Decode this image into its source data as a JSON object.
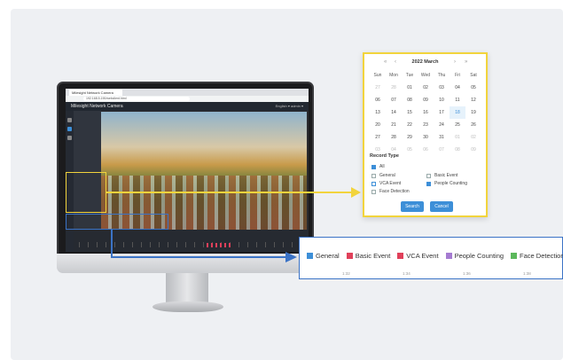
{
  "browser": {
    "tab_title": "Milesight Network Camera",
    "url": "192.168.5.190/webclient.html"
  },
  "app": {
    "brand": "Milesight Network Camera",
    "header_right": "English ▾   admin ▾"
  },
  "calendar": {
    "prev_year": "«",
    "prev_month": "‹",
    "title": "2022 March",
    "next_month": "›",
    "next_year": "»",
    "days_of_week": [
      "Sun",
      "Mon",
      "Tue",
      "Wed",
      "Thu",
      "Fri",
      "Sat"
    ],
    "weeks": [
      [
        "27",
        "28",
        "01",
        "02",
        "03",
        "04",
        "05"
      ],
      [
        "06",
        "07",
        "08",
        "09",
        "10",
        "11",
        "12"
      ],
      [
        "13",
        "14",
        "15",
        "16",
        "17",
        "18",
        "19"
      ],
      [
        "20",
        "21",
        "22",
        "23",
        "24",
        "25",
        "26"
      ],
      [
        "27",
        "28",
        "29",
        "30",
        "31",
        "01",
        "02"
      ],
      [
        "03",
        "04",
        "05",
        "06",
        "07",
        "08",
        "09"
      ]
    ],
    "record_type_title": "Record Type",
    "options": {
      "all": "All",
      "general": "General",
      "basic_event": "Basic Event",
      "vca_event": "VCA Event",
      "people_counting": "People Counting",
      "face_detection": "Face Detection"
    },
    "search_label": "Search",
    "cancel_label": "Cancel"
  },
  "legend": {
    "items": [
      {
        "label": "General",
        "color": "#3d8fd8"
      },
      {
        "label": "Basic Event",
        "color": "#e0405a"
      },
      {
        "label": "VCA Event",
        "color": "#e0405a"
      },
      {
        "label": "People Counting",
        "color": "#a57bd1"
      },
      {
        "label": "Face Detection",
        "color": "#5cb85c"
      }
    ],
    "ticks": [
      "1:32",
      "1:34",
      "1:36",
      "1:38"
    ]
  },
  "colors": {
    "highlight_yellow": "#f2d43c",
    "highlight_blue": "#3b73c6",
    "accent": "#3d8fd8"
  }
}
